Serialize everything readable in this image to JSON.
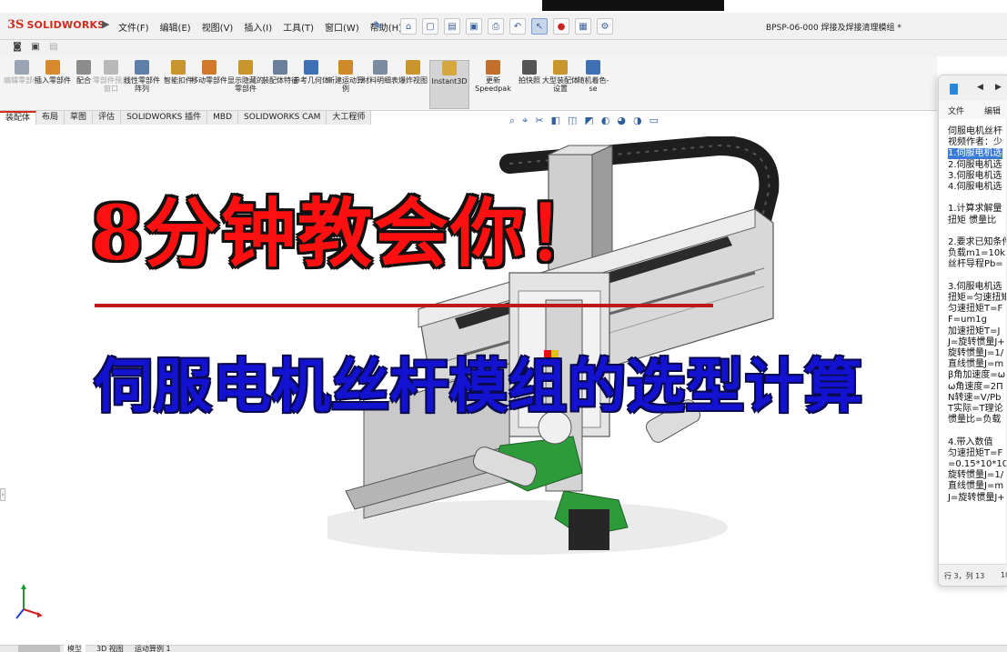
{
  "app": {
    "logo_ds": "3S",
    "logo_name": "SOLIDWORKS",
    "expand_arrow": "▶",
    "document_title": "BPSP-06-000 焊接及焊接清理模组 *"
  },
  "menu": {
    "items": [
      "文件(F)",
      "编辑(E)",
      "视图(V)",
      "插入(I)",
      "工具(T)",
      "窗口(W)",
      "帮助(H)"
    ]
  },
  "quick_access": [
    {
      "icon": "home-icon",
      "glyph": "⌂"
    },
    {
      "icon": "new-document-icon",
      "glyph": "▢"
    },
    {
      "icon": "open-icon",
      "glyph": "▤"
    },
    {
      "icon": "save-icon",
      "glyph": "▣"
    },
    {
      "icon": "print-icon",
      "glyph": "⎙"
    },
    {
      "icon": "undo-icon",
      "glyph": "↶"
    },
    {
      "icon": "select-cursor-icon",
      "glyph": "↖"
    },
    {
      "icon": "rebuild-icon",
      "glyph": "●"
    },
    {
      "icon": "file-properties-icon",
      "glyph": "▦"
    },
    {
      "icon": "options-gear-icon",
      "glyph": "⚙"
    }
  ],
  "ribbon": {
    "tools": [
      {
        "label": "编辑零部件",
        "icon": "edit-component-icon",
        "color": "#9aa4b2",
        "disabled": true
      },
      {
        "label": "插入零部件",
        "icon": "insert-component-icon",
        "color": "#d88a2a",
        "disabled": false
      },
      {
        "label": "配合",
        "icon": "mate-icon",
        "color": "#8c8c8c",
        "disabled": false
      },
      {
        "label": "零部件预览窗口",
        "icon": "component-preview-icon",
        "color": "#b8b8b8",
        "disabled": true
      },
      {
        "label": "线性零部件阵列",
        "icon": "linear-pattern-icon",
        "color": "#5f7fa8",
        "disabled": false
      },
      {
        "label": "智能扣件",
        "icon": "smart-fasteners-icon",
        "color": "#c8952e",
        "disabled": false
      },
      {
        "label": "移动零部件",
        "icon": "move-component-icon",
        "color": "#d17b2a",
        "disabled": false
      },
      {
        "label": "显示隐藏的零部件",
        "icon": "show-hidden-icon",
        "color": "#c8952e",
        "disabled": false
      },
      {
        "label": "装配体特征",
        "icon": "assembly-feature-icon",
        "color": "#6a7f99",
        "disabled": false
      },
      {
        "label": "参考几何体",
        "icon": "reference-geometry-icon",
        "color": "#3f6fb5",
        "disabled": false
      },
      {
        "label": "新建运动算例",
        "icon": "motion-study-icon",
        "color": "#d18a2a",
        "disabled": false
      },
      {
        "label": "材料明细表",
        "icon": "bom-icon",
        "color": "#7b8ba0",
        "disabled": false
      },
      {
        "label": "爆炸视图",
        "icon": "exploded-view-icon",
        "color": "#c8952e",
        "disabled": false
      },
      {
        "label": "Instant3D",
        "icon": "instant3d-icon",
        "color": "#d6a640",
        "disabled": false
      },
      {
        "label": "更新Speedpak",
        "icon": "speedpak-icon",
        "color": "#c0702a",
        "disabled": false
      },
      {
        "label": "拍快照",
        "icon": "snapshot-camera-icon",
        "color": "#555555",
        "disabled": false
      },
      {
        "label": "大型装配体设置",
        "icon": "large-assembly-icon",
        "color": "#c8952e",
        "disabled": false
      },
      {
        "label": "随机着色-se",
        "icon": "random-color-icon",
        "color": "#3f6fb5",
        "disabled": false
      }
    ]
  },
  "tabs": [
    "装配体",
    "布局",
    "草图",
    "评估",
    "SOLIDWORKS 插件",
    "MBD",
    "SOLIDWORKS CAM",
    "大工程师"
  ],
  "overlay": {
    "headline": "8分钟教会你！",
    "subline": "伺服电机丝杆模组的选型计算"
  },
  "bottom_tabs": [
    "模型",
    "3D 视图",
    "运动算例 1"
  ],
  "notepad": {
    "nav_back": "◀",
    "nav_fwd": "▶",
    "menu": [
      "文件",
      "编辑"
    ],
    "lines": [
      "伺服电机丝杆",
      "视频作者：少",
      "1.伺服电机选",
      "2.伺服电机选",
      "3.伺服电机选",
      "4.伺服电机选",
      "",
      "1.计算求解量",
      "扭矩    惯量比",
      "",
      "2.要求已知条件",
      "负载m1=10k",
      "丝杆导程Pb=",
      "",
      "3.伺服电机选",
      "扭矩=匀速扭矩",
      "匀速扭矩T=F",
      "F=um1g",
      "加速扭矩T=J",
      "J=旋转惯量J+",
      "旋转惯量J=1/",
      "直线惯量J=m",
      "β角加速度=ω",
      "ω角速度=2Π",
      "N转速=V/Pb",
      "T实际=T理论",
      "惯量比=负载",
      "",
      "4.带入数值",
      "匀速扭矩T=F",
      "=0.15*10*10",
      "旋转惯量J=1/",
      "直线惯量J=m",
      "J=旋转惯量J+"
    ],
    "highlight_index": 2,
    "status_pos": "行 3，列 13",
    "status_zoom": "10"
  }
}
